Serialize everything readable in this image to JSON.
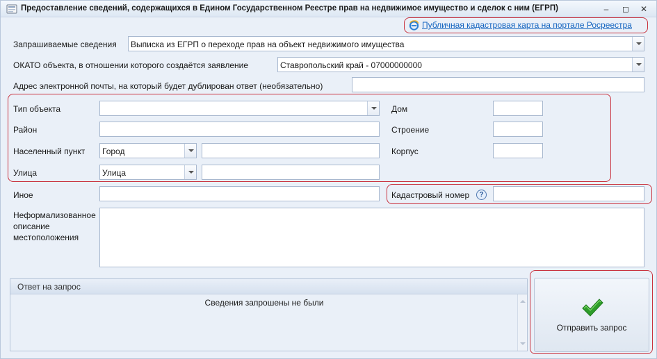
{
  "window": {
    "title": "Предоставление сведений, содержащихся в Едином Государственном Реестре прав на недвижимое имущество и сделок с ним (ЕГРП)",
    "minimize_glyph": "–",
    "restore_glyph": "◻",
    "close_glyph": "✕"
  },
  "top_link": {
    "label": "Публичная кадастровая карта на портале Росреестра"
  },
  "requested_info": {
    "label": "Запрашиваемые сведения",
    "value": "Выписка из ЕГРП о переходе прав на объект недвижимого имущества"
  },
  "okato": {
    "label": "ОКАТО объекта, в отношении которого создаётся заявление",
    "value": "Ставропольский край - 07000000000"
  },
  "email": {
    "label": "Адрес электронной почты, на который будет дублирован ответ (необязательно)",
    "value": ""
  },
  "address": {
    "object_type": {
      "label": "Тип объекта",
      "value": ""
    },
    "district": {
      "label": "Район",
      "value": ""
    },
    "locality": {
      "label": "Населенный пункт",
      "type_value": "Город",
      "value": ""
    },
    "street": {
      "label": "Улица",
      "type_value": "Улица",
      "value": ""
    },
    "house": {
      "label": "Дом",
      "value": ""
    },
    "building": {
      "label": "Строение",
      "value": ""
    },
    "block": {
      "label": "Корпус",
      "value": ""
    }
  },
  "other": {
    "label": "Иное",
    "value": ""
  },
  "cadastral": {
    "label": "Кадастровый номер",
    "help_glyph": "?",
    "value": ""
  },
  "location_desc": {
    "label_line1": "Неформализованное",
    "label_line2": "описание",
    "label_line3": "местоположения",
    "value": ""
  },
  "response": {
    "header": "Ответ на запрос",
    "text": "Сведения запрошены не были"
  },
  "send_button": {
    "label": "Отправить запрос"
  },
  "icons": {
    "app": "form-icon",
    "link": "ie-browser-icon",
    "help": "help-icon",
    "send": "checkmark-icon"
  },
  "colors": {
    "accent_red": "#c9323e",
    "link_blue": "#1565c0",
    "check_green": "#2e9d2a"
  }
}
